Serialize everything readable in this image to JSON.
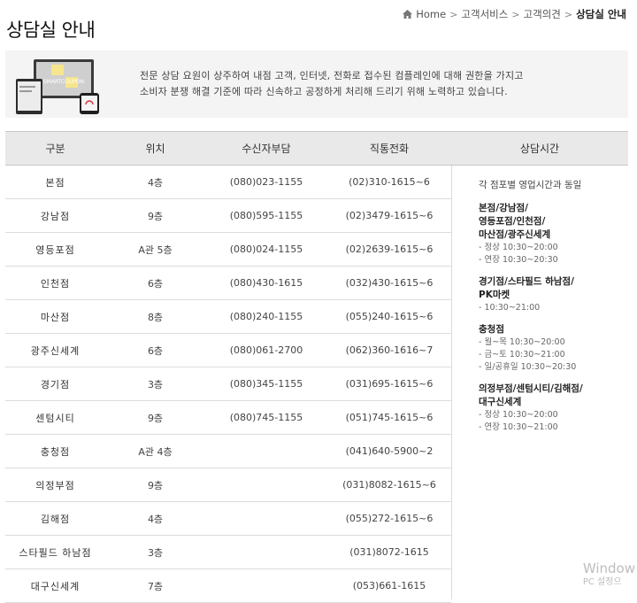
{
  "page": {
    "title": "상담실 안내"
  },
  "breadcrumb": {
    "items": [
      "Home",
      "고객서비스",
      "고객의견",
      "상담실 안내"
    ]
  },
  "intro": {
    "screen_text": "SMARTCOUPON",
    "line1": "전문 상담 요원이 상주하여 내점 고객, 인터넷, 전화로 접수된 컴플레인에 대해 권한을 가지고",
    "line2": "소비자 분쟁 해결 기준에 따라 신속하고 공정하게 처리해 드리기 위해 노력하고 있습니다."
  },
  "table": {
    "headers": [
      "구분",
      "위치",
      "수신자부담",
      "직통전화",
      "상담시간"
    ],
    "rows": [
      {
        "branch": "본점",
        "location": "4층",
        "free": "(080)023-1155",
        "direct": "(02)310-1615~6"
      },
      {
        "branch": "강남점",
        "location": "9층",
        "free": "(080)595-1155",
        "direct": "(02)3479-1615~6"
      },
      {
        "branch": "영등포점",
        "location": "A관 5층",
        "free": "(080)024-1155",
        "direct": "(02)2639-1615~6"
      },
      {
        "branch": "인천점",
        "location": "6층",
        "free": "(080)430-1615",
        "direct": "(032)430-1615~6"
      },
      {
        "branch": "마산점",
        "location": "8층",
        "free": "(080)240-1155",
        "direct": "(055)240-1615~6"
      },
      {
        "branch": "광주신세계",
        "location": "6층",
        "free": "(080)061-2700",
        "direct": "(062)360-1616~7"
      },
      {
        "branch": "경기점",
        "location": "3층",
        "free": "(080)345-1155",
        "direct": "(031)695-1615~6"
      },
      {
        "branch": "센텀시티",
        "location": "9층",
        "free": "(080)745-1155",
        "direct": "(051)745-1615~6"
      },
      {
        "branch": "충청점",
        "location": "A관 4층",
        "free": "",
        "direct": "(041)640-5900~2"
      },
      {
        "branch": "의정부점",
        "location": "9층",
        "free": "",
        "direct": "(031)8082-1615~6"
      },
      {
        "branch": "김해점",
        "location": "4층",
        "free": "",
        "direct": "(055)272-1615~6"
      },
      {
        "branch": "스타필드 하남점",
        "location": "3층",
        "free": "",
        "direct": "(031)8072-1615"
      },
      {
        "branch": "대구신세계",
        "location": "7층",
        "free": "",
        "direct": "(053)661-1615"
      }
    ],
    "hours": {
      "common": "각 점포별 영업시간과 동일",
      "groups": [
        {
          "title": "본점/강남점/\n영등포점/인천점/\n마산점/광주신세계",
          "lines": [
            "- 정상 10:30~20:00",
            "- 연장 10:30~20:30"
          ]
        },
        {
          "title": "경기점/스타필드 하남점/\nPK마켓",
          "lines": [
            "- 10:30~21:00"
          ]
        },
        {
          "title": "충청점",
          "lines": [
            "- 월~목 10:30~20:00",
            "- 금~토 10:30~21:00",
            "- 일/공휴일 10:30~20:30"
          ]
        },
        {
          "title": "의정부점/센텀시티/김해점/\n대구신세계",
          "lines": [
            "- 정상 10:30~20:00",
            "- 연장 10:30~21:00"
          ]
        }
      ]
    }
  },
  "watermark": {
    "line1": "Window",
    "line2": "PC 설정으"
  },
  "colors": {
    "header_bg": "#e9e9e9",
    "intro_bg": "#f4f4f4",
    "border": "#dcdcdc"
  }
}
